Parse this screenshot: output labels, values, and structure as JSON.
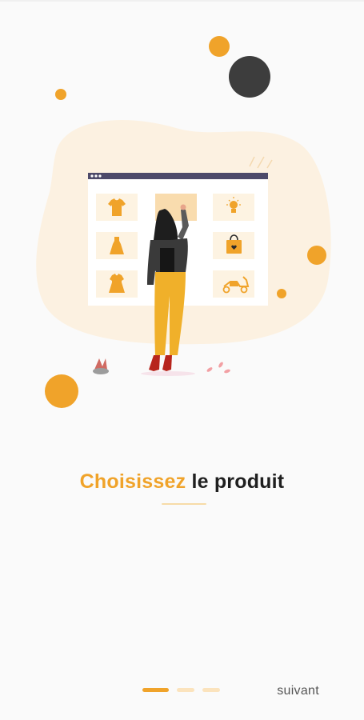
{
  "colors": {
    "accent": "#f0a32a",
    "accent_light": "#fbe3bd",
    "blob": "#fcf1e1",
    "dark_circle": "#3d3d3d",
    "window_bar": "#4d4a6a",
    "text_dark": "#1f1f1f",
    "text_muted": "#555555"
  },
  "onboarding": {
    "headline_accent": "Choisissez",
    "headline_rest": "le produit",
    "next_label": "suivant",
    "pages_total": 3,
    "current_page": 1
  },
  "illustration": {
    "product_icons": [
      "t-shirt-icon",
      "dress-icon",
      "baby-dress-icon",
      "light-bulb-icon",
      "shopping-bag-icon",
      "scooter-icon"
    ]
  }
}
